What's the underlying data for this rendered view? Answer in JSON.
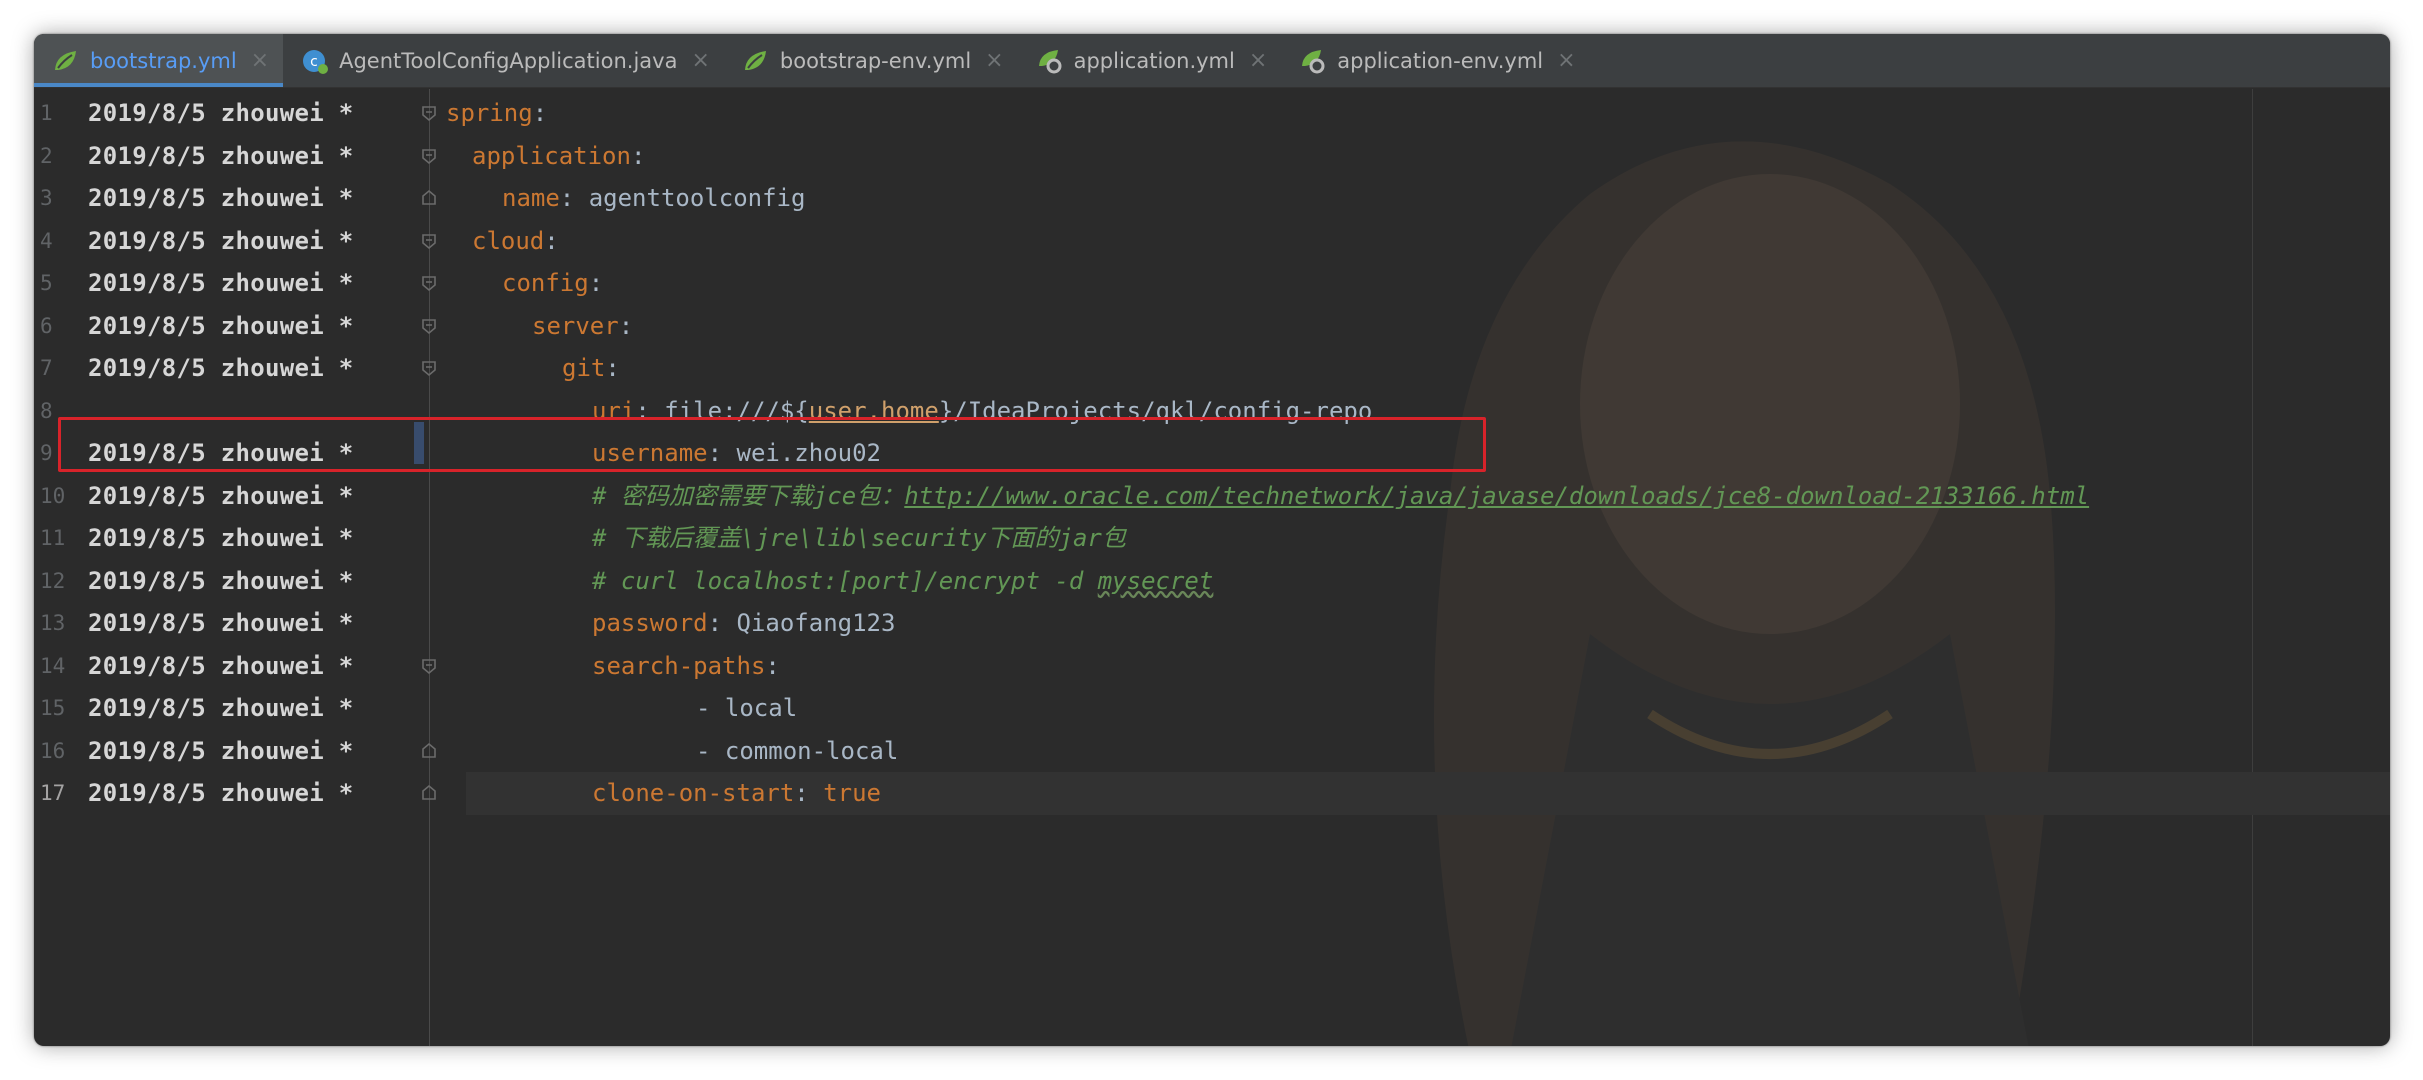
{
  "tabs": [
    {
      "label": "bootstrap.yml",
      "icon": "spring-leaf-icon",
      "active": true
    },
    {
      "label": "AgentToolConfigApplication.java",
      "icon": "java-class-icon",
      "active": false
    },
    {
      "label": "bootstrap-env.yml",
      "icon": "spring-leaf-icon",
      "active": false
    },
    {
      "label": "application.yml",
      "icon": "spring-gear-icon",
      "active": false
    },
    {
      "label": "application-env.yml",
      "icon": "spring-gear-icon",
      "active": false
    }
  ],
  "close_glyph": "×",
  "blame": {
    "date": "2019/8/5",
    "author": "zhouwei",
    "star": "*"
  },
  "lines": [
    {
      "n": "1"
    },
    {
      "n": "2"
    },
    {
      "n": "3"
    },
    {
      "n": "4"
    },
    {
      "n": "5"
    },
    {
      "n": "6"
    },
    {
      "n": "7"
    },
    {
      "n": "8"
    },
    {
      "n": "9"
    },
    {
      "n": "10"
    },
    {
      "n": "11"
    },
    {
      "n": "12"
    },
    {
      "n": "13"
    },
    {
      "n": "14"
    },
    {
      "n": "15"
    },
    {
      "n": "16"
    },
    {
      "n": "17"
    }
  ],
  "code": {
    "l1_key": "spring",
    "l2_key": "application",
    "l3_key": "name",
    "l3_val": "agenttoolconfig",
    "l4_key": "cloud",
    "l5_key": "config",
    "l6_key": "server",
    "l7_key": "git",
    "l8_key": "uri",
    "l8_pre": "file:///${",
    "l8_var": "user.home",
    "l8_post": "}/IdeaProjects/qkl/config-repo",
    "l9_key": "username",
    "l9_val": "wei.zhou02",
    "l10_comment": "# 密码加密需要下载jce包：",
    "l10_link": "http://www.oracle.com/technetwork/java/javase/downloads/jce8-download-2133166.html",
    "l11_comment": "# 下载后覆盖\\jre\\lib\\security下面的jar包",
    "l12_comment": "# curl localhost:[port]/encrypt -d ",
    "l12_word": "mysecret",
    "l13_key": "password",
    "l13_val": "Qiaofang123",
    "l14_key": "search-paths",
    "l15_val": "- local",
    "l16_val": "- common-local",
    "l17_key": "clone-on-start",
    "l17_val": "true"
  },
  "colon": ":",
  "colors": {
    "accent": "#589df6",
    "keyword": "#cc7832",
    "comment": "#629755",
    "highlight": "#d8232a"
  }
}
